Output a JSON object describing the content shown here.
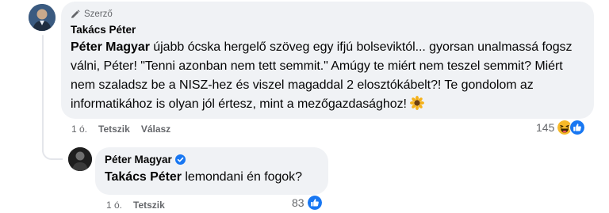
{
  "main_comment": {
    "badge": "Szerző",
    "author": "Takács Péter",
    "mention": "Péter Magyar",
    "text": " újabb ócska hergelő szöveg egy ifjú bolseviktól... gyorsan unalmassá fogsz válni, Péter! \"Tenni azonban nem tett semmit.\" Amúgy te miért nem teszel semmit? Miért nem szaladsz be a NISZ-hez és viszel magaddal 2 elosztókábelt?! Te gondolom az informatikához is olyan jól értesz, mint a mezőgazdasághoz!",
    "emoji": "sunflower-emoji",
    "time": "1 ó.",
    "like_label": "Tetszik",
    "reply_label": "Válasz",
    "reaction_count": "145",
    "reaction_icons": [
      "haha-icon",
      "like-icon"
    ]
  },
  "reply_comment": {
    "author": "Péter Magyar",
    "verified": true,
    "mention": "Takács Péter",
    "text": " lemondani én fogok?",
    "time": "1 ó.",
    "like_label": "Tetszik",
    "reaction_count": "83",
    "reaction_icons": [
      "like-icon"
    ]
  },
  "colors": {
    "bubble": "#f0f2f5",
    "meta": "#65676b",
    "like_blue": "#1877f2",
    "haha_yellow": "#f7b928",
    "verified_blue": "#1877f2"
  }
}
